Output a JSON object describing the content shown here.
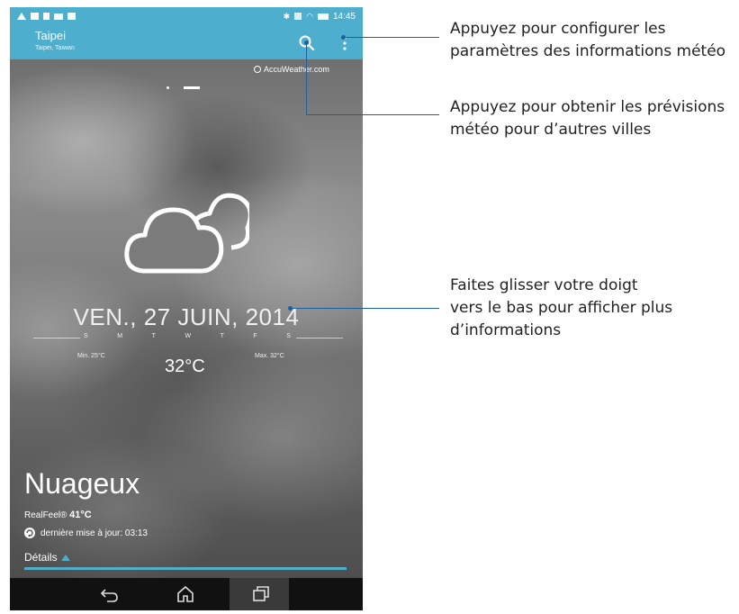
{
  "status_bar": {
    "time": "14:45",
    "left_icons": [
      "warning-icon",
      "image-icon",
      "lock-icon",
      "mail-icon",
      "media-icon"
    ],
    "right_icons": [
      "bluetooth-icon",
      "signal-icon",
      "wifi-icon",
      "battery-icon"
    ]
  },
  "app_bar": {
    "city": "Taipei",
    "city_sub": "Taipei, Taiwan",
    "search_icon": "search-icon",
    "menu_icon": "overflow-menu-icon",
    "accent": "#4eaecd"
  },
  "provider": "AccuWeather.com",
  "weather": {
    "icon": "cloudy-icon",
    "date": "VEN., 27 JUIN, 2014",
    "week_days": [
      "S",
      "M",
      "T",
      "W",
      "T",
      "F",
      "S"
    ],
    "min": "Min. 25°C",
    "max": "Max. 32°C",
    "temperature": "32°C",
    "condition": "Nuageux",
    "realfeel_label": "RealFeel®",
    "realfeel_value": "41°C",
    "last_update": "dernière mise à jour: 03:13",
    "details_label": "Détails"
  },
  "nav_bar": {
    "back_icon": "back-icon",
    "home_icon": "home-icon",
    "recent_icon": "recent-apps-icon"
  },
  "annotations": {
    "settings_line1": "Appuyez pour configurer les",
    "settings_line2": "paramètres des informations météo",
    "search_line1": "Appuyez pour obtenir les prévisions",
    "search_line2": "météo pour d’autres villes",
    "swipe_line1": "Faites glisser votre doigt",
    "swipe_line2": "vers le bas pour afficher plus",
    "swipe_line3": "d’informations",
    "line_color": "#1e5f9c"
  }
}
